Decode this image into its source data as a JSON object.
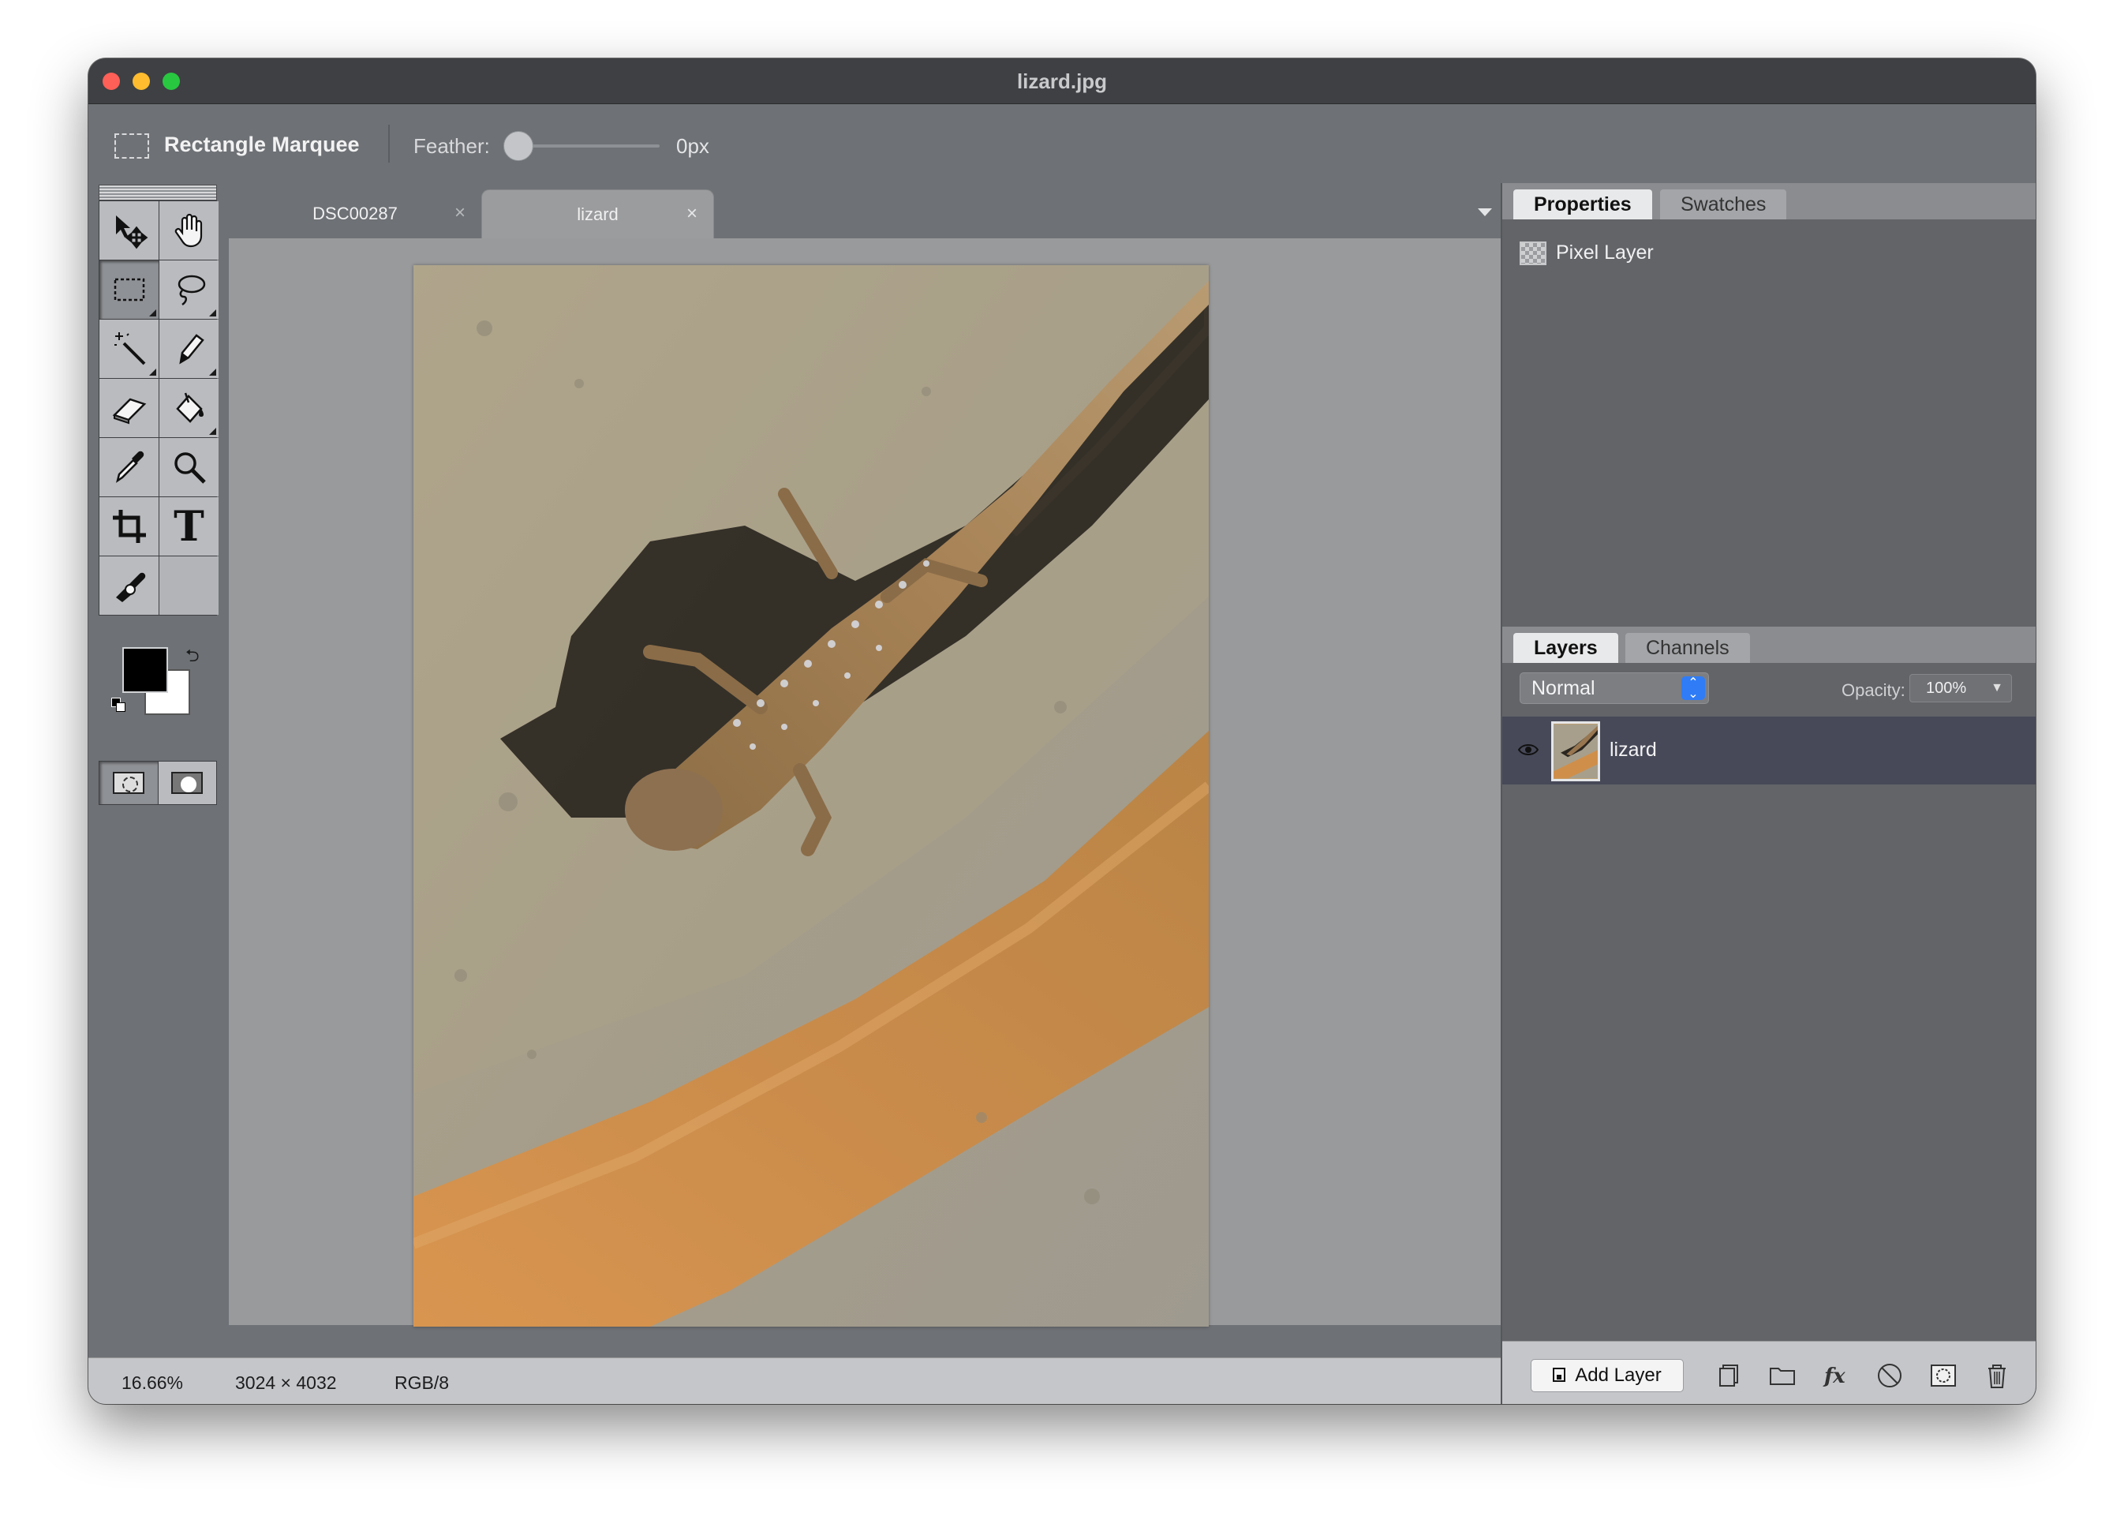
{
  "window": {
    "title": "lizard.jpg"
  },
  "options": {
    "tool_icon": "rectangle-marquee-icon",
    "tool_name": "Rectangle Marquee",
    "feather_label": "Feather:",
    "feather_value": "0px",
    "feather_fraction": 0
  },
  "toolbox": {
    "tools": [
      "move-icon",
      "hand-icon",
      "rectangle-marquee-icon",
      "lasso-icon",
      "magic-wand-icon",
      "pencil-icon",
      "eraser-icon",
      "paint-bucket-icon",
      "eyedropper-icon",
      "zoom-icon",
      "crop-icon",
      "type-icon",
      "clone-stamp-icon",
      "empty-slot"
    ],
    "active_tool": "rectangle-marquee-icon",
    "type_glyph": "T",
    "foreground_color": "#000000",
    "background_color": "#ffffff"
  },
  "document_tabs": [
    {
      "label": "DSC00287",
      "active": false
    },
    {
      "label": "lizard",
      "active": true
    }
  ],
  "tab_add_label": "+",
  "status": {
    "zoom": "16.66%",
    "dimensions": "3024 × 4032",
    "mode": "RGB/8"
  },
  "properties_panel": {
    "tabs": [
      "Properties",
      "Swatches"
    ],
    "active_tab": "Properties",
    "layer_type": "Pixel Layer"
  },
  "layers_panel": {
    "tabs": [
      "Layers",
      "Channels"
    ],
    "active_tab": "Layers",
    "blend_mode": "Normal",
    "opacity_label": "Opacity:",
    "opacity_value": "100%",
    "layers": [
      {
        "name": "lizard",
        "visible": true,
        "selected": true
      }
    ],
    "add_layer_label": "Add Layer",
    "footer_icons": [
      "duplicate-layer-icon",
      "folder-icon",
      "fx-icon",
      "adjustment-icon",
      "mask-icon",
      "trash-icon"
    ]
  },
  "colors": {
    "window_bg": "#6e7175",
    "titlebar": "#3e4043",
    "selected_layer": "#474958",
    "accent": "#2f7cf6"
  }
}
